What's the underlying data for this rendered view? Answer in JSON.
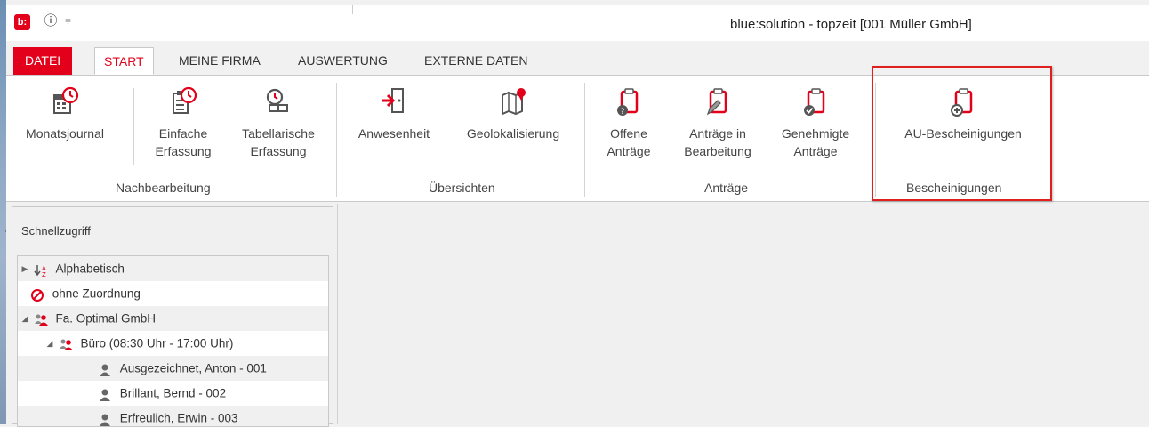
{
  "window": {
    "app_logo_text": "b:",
    "title": "blue:solution - topzeit [001 Müller GmbH]",
    "info_icon": "info-icon",
    "quick_access_icon": "quick-access-dropdown-icon"
  },
  "tabs": [
    {
      "label": "DATEI"
    },
    {
      "label": "START"
    },
    {
      "label": "MEINE FIRMA"
    },
    {
      "label": "AUSWERTUNG"
    },
    {
      "label": "EXTERNE DATEN"
    }
  ],
  "ribbon": {
    "groups": [
      {
        "label": "Nachbearbeitung",
        "buttons": [
          {
            "line1": "Monatsjournal",
            "line2": "",
            "icon": "calendar-clock-icon"
          },
          {
            "line1": "Einfache",
            "line2": "Erfassung",
            "icon": "clipboard-clock-icon"
          },
          {
            "line1": "Tabellarische",
            "line2": "Erfassung",
            "icon": "clock-table-icon"
          }
        ]
      },
      {
        "label": "Übersichten",
        "buttons": [
          {
            "line1": "Anwesenheit",
            "line2": "",
            "icon": "door-enter-icon"
          },
          {
            "line1": "Geolokalisierung",
            "line2": "",
            "icon": "map-pin-icon"
          }
        ]
      },
      {
        "label": "Anträge",
        "buttons": [
          {
            "line1": "Offene",
            "line2": "Anträge",
            "icon": "clipboard-question-icon"
          },
          {
            "line1": "Anträge in",
            "line2": "Bearbeitung",
            "icon": "clipboard-edit-icon"
          },
          {
            "line1": "Genehmigte",
            "line2": "Anträge",
            "icon": "clipboard-check-icon"
          }
        ]
      },
      {
        "label": "Bescheinigungen",
        "buttons": [
          {
            "line1": "AU-Bescheinigungen",
            "line2": "",
            "icon": "clipboard-plus-icon"
          }
        ]
      }
    ]
  },
  "quick_access": {
    "title": "Schnellzugriff",
    "tree": [
      {
        "label": "Alphabetisch",
        "icon": "sort-alpha-icon",
        "expander": "collapsed"
      },
      {
        "label": "ohne Zuordnung",
        "icon": "no-entry-icon",
        "expander": "none"
      },
      {
        "label": "Fa. Optimal GmbH",
        "icon": "group-icon",
        "expander": "expanded"
      },
      {
        "label": "Büro (08:30 Uhr - 17:00 Uhr)",
        "icon": "group-icon",
        "expander": "expanded"
      },
      {
        "label": "Ausgezeichnet, Anton - 001",
        "icon": "person-icon",
        "expander": "none"
      },
      {
        "label": "Brillant, Bernd - 002",
        "icon": "person-icon",
        "expander": "none"
      },
      {
        "label": "Erfreulich, Erwin - 003",
        "icon": "person-icon",
        "expander": "none"
      }
    ]
  },
  "colors": {
    "accent": "#e2001a",
    "highlight_border": "#e01f1f",
    "text": "#444444"
  }
}
